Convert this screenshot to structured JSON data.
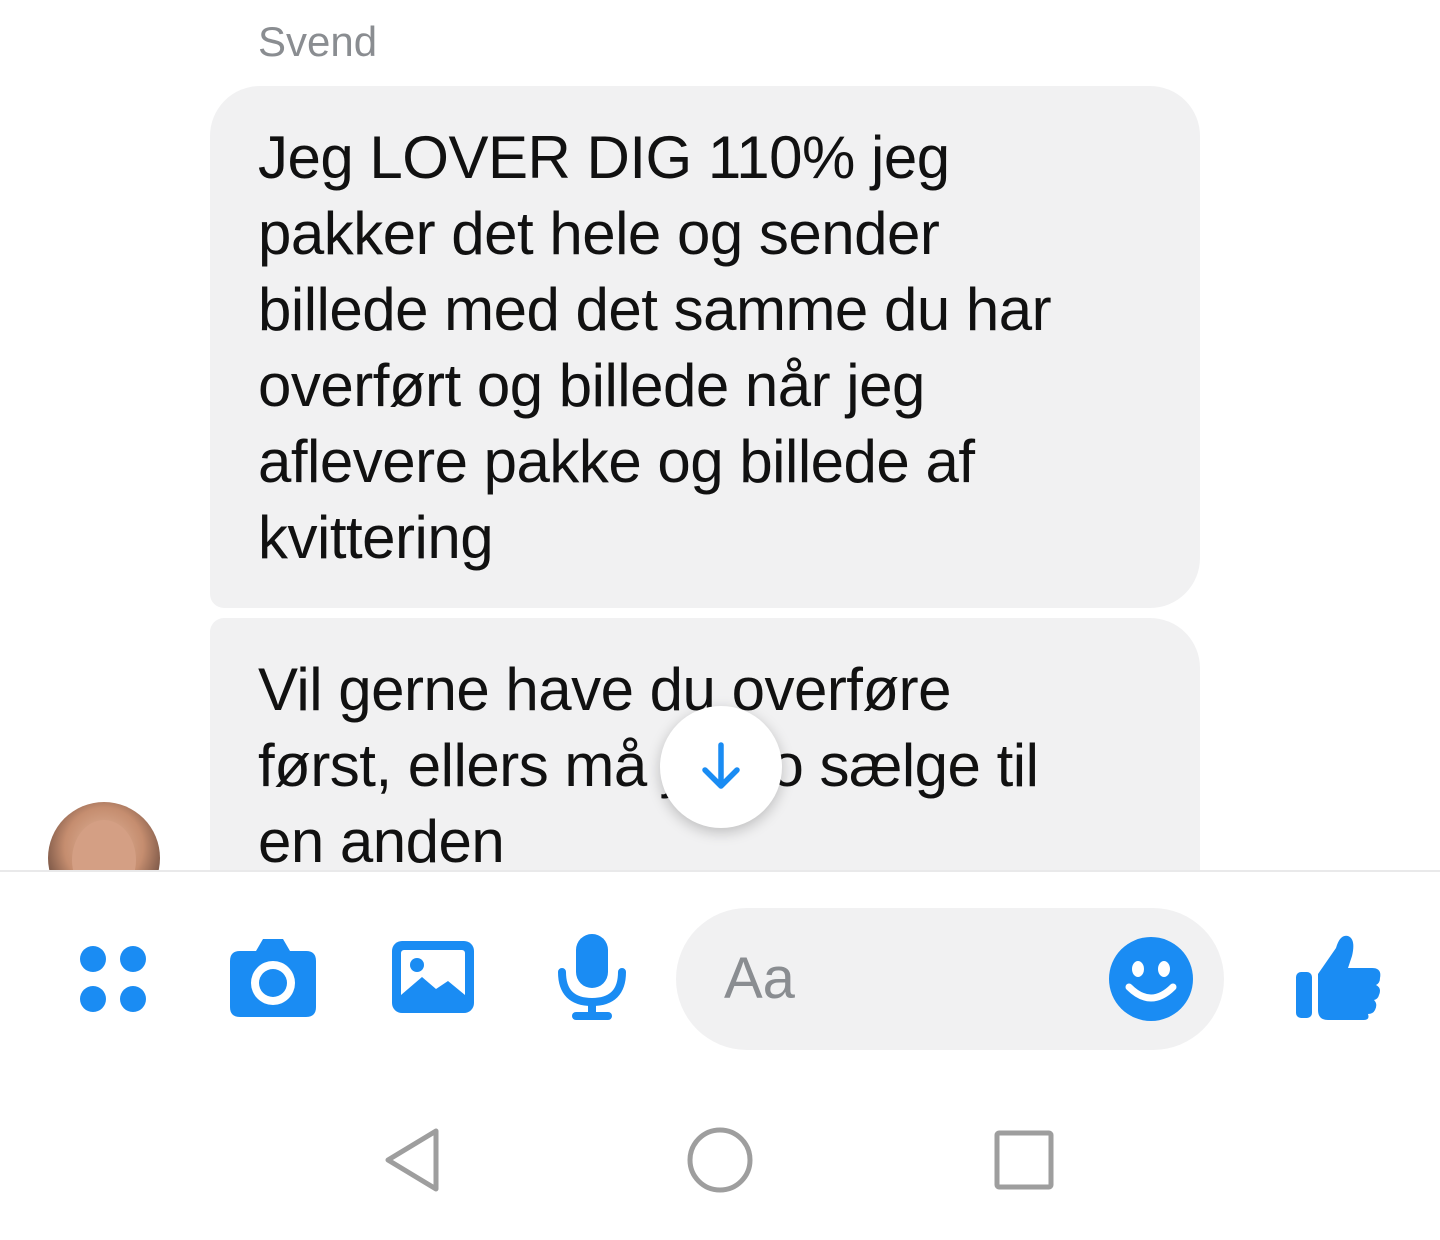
{
  "thread": {
    "sender_name": "Svend",
    "messages": [
      {
        "text": "Jeg LOVER DIG 110% jeg\npakker det hele og sender\nbillede med det samme du har\noverført og billede når jeg\naflevere pakke og billede af\nkvittering"
      },
      {
        "text": "Vil gerne have du overføre\nførst, ellers må jeg jo sælge til\nen anden"
      }
    ]
  },
  "composer": {
    "input_placeholder": "Aa",
    "icons": [
      "apps-icon",
      "camera-icon",
      "gallery-icon",
      "microphone-icon",
      "emoji-icon",
      "thumbs-up-icon"
    ]
  },
  "navigation": {
    "icons": [
      "back-icon",
      "home-icon",
      "recents-icon"
    ]
  },
  "colors": {
    "accent": "#1a8cf3",
    "bubble": "#f1f1f2",
    "muted_text": "#8a8d91",
    "nav_icon": "#9e9e9e"
  }
}
